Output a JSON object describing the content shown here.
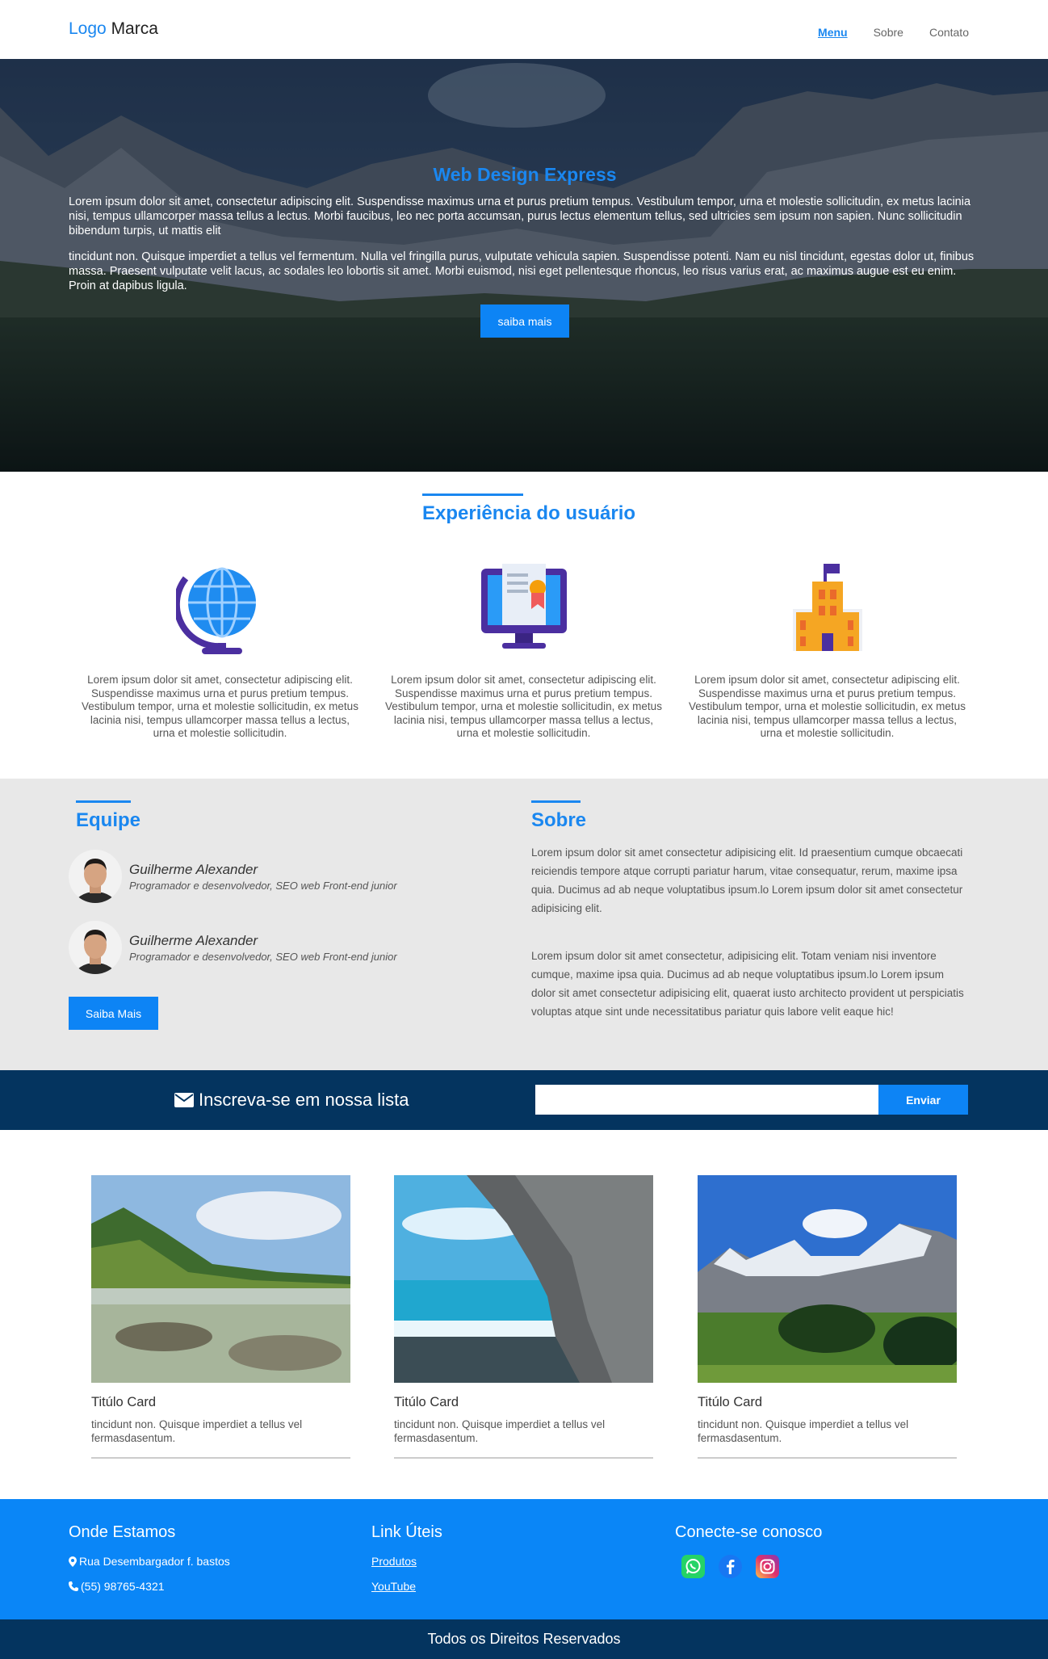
{
  "header": {
    "logo_first": "Logo",
    "logo_second": "Marca",
    "nav": [
      {
        "label": "Menu",
        "active": true
      },
      {
        "label": "Sobre",
        "active": false
      },
      {
        "label": "Contato",
        "active": false
      }
    ]
  },
  "hero": {
    "title": "Web Design Express",
    "paragraph1": "Lorem ipsum dolor sit amet, consectetur adipiscing elit. Suspendisse maximus urna et purus pretium tempus. Vestibulum tempor, urna et molestie sollicitudin, ex metus lacinia nisi, tempus ullamcorper massa tellus a lectus. Morbi faucibus, leo nec porta accumsan, purus lectus elementum tellus, sed ultricies sem ipsum non sapien. Nunc sollicitudin bibendum turpis, ut mattis elit",
    "paragraph2": "tincidunt non. Quisque imperdiet a tellus vel fermentum. Nulla vel fringilla purus, vulputate vehicula sapien. Suspendisse potenti. Nam eu nisl tincidunt, egestas dolor ut, finibus massa. Praesent vulputate velit lacus, ac sodales leo lobortis sit amet. Morbi euismod, nisi eget pellentesque rhoncus, leo risus varius erat, ac maximus augue est eu enim. Proin at dapibus ligula.",
    "button": "saiba mais"
  },
  "experience": {
    "title": "Experiência do usuário",
    "columns": [
      {
        "icon": "globe-icon",
        "text": "Lorem ipsum dolor sit amet, consectetur adipiscing elit. Suspendisse maximus urna et purus pretium tempus. Vestibulum tempor, urna et molestie sollicitudin, ex metus lacinia nisi, tempus ullamcorper massa tellus a lectus, urna et molestie sollicitudin."
      },
      {
        "icon": "monitor-certificate-icon",
        "text": "Lorem ipsum dolor sit amet, consectetur adipiscing elit. Suspendisse maximus urna et purus pretium tempus. Vestibulum tempor, urna et molestie sollicitudin, ex metus lacinia nisi, tempus ullamcorper massa tellus a lectus, urna et molestie sollicitudin."
      },
      {
        "icon": "building-flag-icon",
        "text": "Lorem ipsum dolor sit amet, consectetur adipiscing elit. Suspendisse maximus urna et purus pretium tempus. Vestibulum tempor, urna et molestie sollicitudin, ex metus lacinia nisi, tempus ullamcorper massa tellus a lectus, urna et molestie sollicitudin."
      }
    ]
  },
  "team": {
    "title": "Equipe",
    "members": [
      {
        "name": "Guilherme Alexander",
        "role": "Programador e desenvolvedor, SEO web Front-end junior"
      },
      {
        "name": "Guilherme Alexander",
        "role": "Programador e desenvolvedor, SEO web Front-end junior"
      }
    ],
    "button": "Saiba Mais"
  },
  "about": {
    "title": "Sobre",
    "paragraph1": "Lorem ipsum dolor sit amet consectetur adipisicing elit. Id praesentium cumque obcaecati reiciendis tempore atque corrupti pariatur harum, vitae consequatur, rerum, maxime ipsa quia. Ducimus ad ab neque voluptatibus ipsum.lo Lorem ipsum dolor sit amet consectetur adipisicing elit.",
    "paragraph2": "Lorem ipsum dolor sit amet consectetur, adipisicing elit. Totam veniam nisi inventore cumque, maxime ipsa quia. Ducimus ad ab neque voluptatibus ipsum.lo Lorem ipsum dolor sit amet consectetur adipisicing elit, quaerat iusto architecto provident ut perspiciatis voluptas atque sint unde necessitatibus pariatur quis labore velit eaque hic!"
  },
  "newsletter": {
    "label": "Inscreva-se em nossa lista",
    "input_value": "",
    "button": "Enviar"
  },
  "cards": [
    {
      "title": "Titúlo Card",
      "text": "tincidunt non. Quisque imperdiet a tellus vel fermasdasentum."
    },
    {
      "title": "Titúlo Card",
      "text": "tincidunt non. Quisque imperdiet a tellus vel fermasdasentum."
    },
    {
      "title": "Titúlo Card",
      "text": "tincidunt non. Quisque imperdiet a tellus vel fermasdasentum."
    }
  ],
  "footer": {
    "location_title": "Onde Estamos",
    "address": "Rua Desembargador f. bastos",
    "phone": "(55) 98765-4321",
    "links_title": "Link Úteis",
    "links": [
      "Produtos",
      "YouTube"
    ],
    "social_title": "Conecte-se conosco",
    "social": [
      "whatsapp-icon",
      "facebook-icon",
      "instagram-icon"
    ]
  },
  "copyright": "Todos os Direitos Reservados",
  "colors": {
    "accent": "#1a87f0",
    "dark_blue": "#04345f",
    "footer_blue": "#0a86f7",
    "light_gray": "#e8e8e8"
  }
}
